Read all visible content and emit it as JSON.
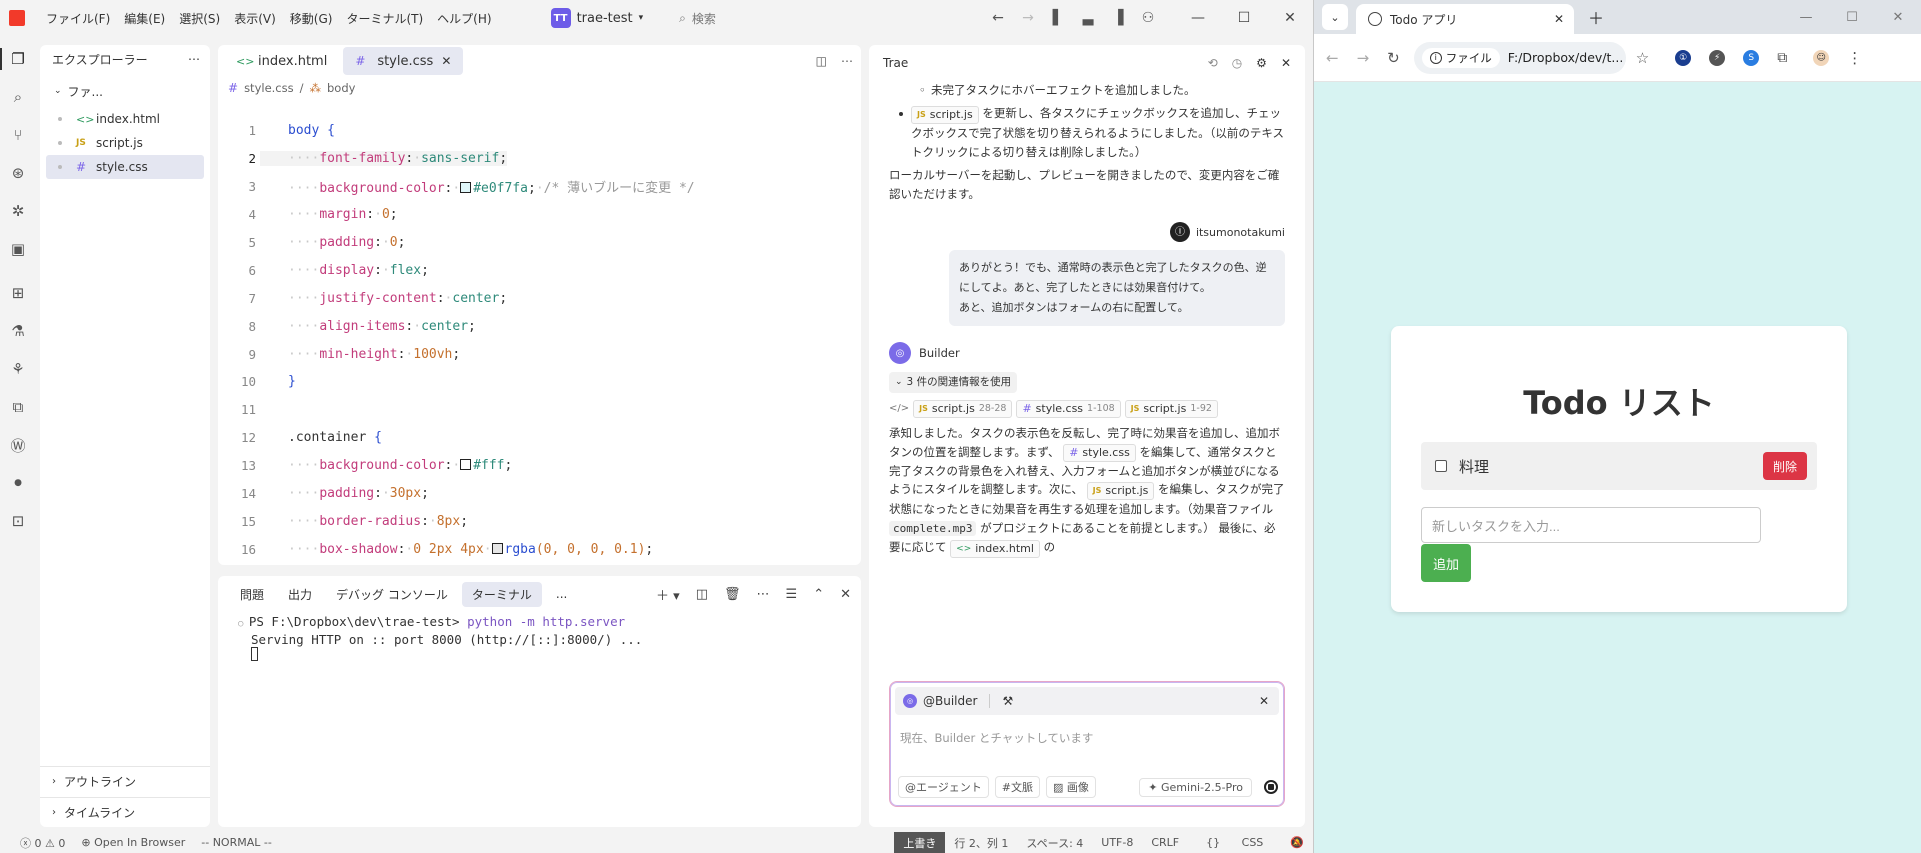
{
  "ide": {
    "menu": [
      "ファイル(F)",
      "編集(E)",
      "選択(S)",
      "表示(V)",
      "移動(G)",
      "ターミナル(T)",
      "ヘルプ(H)"
    ],
    "project": {
      "badge": "TT",
      "name": "trae-test"
    },
    "search_placeholder": "検索",
    "explorer": {
      "title": "エクスプローラー",
      "folder": "ファ...",
      "files": [
        {
          "name": "index.html",
          "type": "html"
        },
        {
          "name": "script.js",
          "type": "js"
        },
        {
          "name": "style.css",
          "type": "css"
        }
      ],
      "outline": "アウトライン",
      "timeline": "タイムライン"
    },
    "editor": {
      "tabs": [
        {
          "name": "index.html",
          "icon": "<>"
        },
        {
          "name": "style.css",
          "icon": "#"
        }
      ],
      "breadcrumb": {
        "file": "style.css",
        "symbol": "body"
      },
      "line_numbers": [
        "1",
        "2",
        "3",
        "4",
        "5",
        "6",
        "7",
        "8",
        "9",
        "10",
        "11",
        "12",
        "13",
        "14",
        "15",
        "16"
      ],
      "code": {
        "l1_sel": "body",
        "l1_brace": "{",
        "l2_prop": "font-family",
        "l2_val": "sans-serif",
        "l3_prop": "background-color",
        "l3_val": "#e0f7fa",
        "l3_comment": "/* 薄いブルーに変更 */",
        "l4_prop": "margin",
        "l4_val": "0",
        "l5_prop": "padding",
        "l5_val": "0",
        "l6_prop": "display",
        "l6_val": "flex",
        "l7_prop": "justify-content",
        "l7_val": "center",
        "l8_prop": "align-items",
        "l8_val": "center",
        "l9_prop": "min-height",
        "l9_val": "100vh",
        "l10": "}",
        "l12_sel": ".container",
        "l12_brace": "{",
        "l13_prop": "background-color",
        "l13_val": "#fff",
        "l14_prop": "padding",
        "l14_val": "30px",
        "l15_prop": "border-radius",
        "l15_val": "8px",
        "l16_prop": "box-shadow",
        "l16_vals": "0 2px 4px",
        "l16_fn": "rgba",
        "l16_args": "(0, 0, 0, 0.1)"
      }
    },
    "panel": {
      "tabs": [
        "問題",
        "出力",
        "デバッグ コンソール",
        "ターミナル",
        "..."
      ],
      "terminal": {
        "prompt": "PS F:\\Dropbox\\dev\\trae-test>",
        "command": "python -m http.server",
        "output": "Serving HTTP on :: port 8000 (http://[::]:8000/) ..."
      }
    },
    "chat": {
      "title": "Trae",
      "bullet1": "未完了タスクにホバーエフェクトを追加しました。",
      "bullet2_chip": "script.js",
      "bullet2_text": "を更新し、各タスクにチェックボックスを追加し、チェックボックスで完了状態を切り替えられるようにしました。（以前のテキストクリックによる切り替えは削除しました。）",
      "para1": "ローカルサーバーを起動し、プレビューを開きましたので、変更内容をご確認いただけます。",
      "user_name": "itsumonotakumi",
      "user_msg1": "ありがとう！でも、通常時の表示色と完了したタスクの色、逆にしてよ。あと、完了したときには効果音付けて。",
      "user_msg2": "あと、追加ボタンはフォームの右に配置して。",
      "bot_name": "Builder",
      "context_label": "3 件の関連情報を使用",
      "context_files": [
        {
          "name": "script.js",
          "range": "28-28",
          "type": "js"
        },
        {
          "name": "style.css",
          "range": "1-108",
          "type": "css"
        },
        {
          "name": "script.js",
          "range": "1-92",
          "type": "js"
        }
      ],
      "reply_a": "承知しました。タスクの表示色を反転し、完了時に効果音を追加し、追加ボタンの位置を調整します。まず、",
      "reply_chip1": "style.css",
      "reply_b": "を編集して、通常タスクと完了タスクの背景色を入れ替え、入力フォームと追加ボタンが横並びになるようにスタイルを調整します。次に、",
      "reply_chip2": "script.js",
      "reply_c": "を編集し、タスクが完了状態になったときに効果音を再生する処理を追加します。（効果音ファイル",
      "reply_code": "complete.mp3",
      "reply_d": "がプロジェクトにあることを前提とします。） 最後に、必要に応じて",
      "reply_chip3": "index.html",
      "reply_e": "の",
      "input": {
        "agent": "@Builder",
        "placeholder": "現在、Builder とチャットしています",
        "btn_agent": "@エージェント",
        "btn_context": "#文脈",
        "btn_image": "画像",
        "model": "Gemini-2.5-Pro"
      }
    },
    "status": {
      "errors": "0",
      "warnings": "0",
      "open_browser": "Open In Browser",
      "mode": "-- NORMAL --",
      "overwrite": "上書き",
      "position": "行 2、列 1",
      "spaces": "スペース: 4",
      "encoding": "UTF-8",
      "eol": "CRLF",
      "language": "CSS"
    }
  },
  "browser": {
    "tab_title": "Todo アプリ",
    "url_badge": "ファイル",
    "url": "F:/Dropbox/dev/t...",
    "todo": {
      "title": "Todo リスト",
      "item": "料理",
      "delete": "削除",
      "input_placeholder": "新しいタスクを入力...",
      "add": "追加"
    }
  },
  "colors": {
    "accent": "#6d5ce8",
    "page_bg": "#e0f7fa",
    "delete": "#dc3545",
    "add": "#4caf50"
  }
}
